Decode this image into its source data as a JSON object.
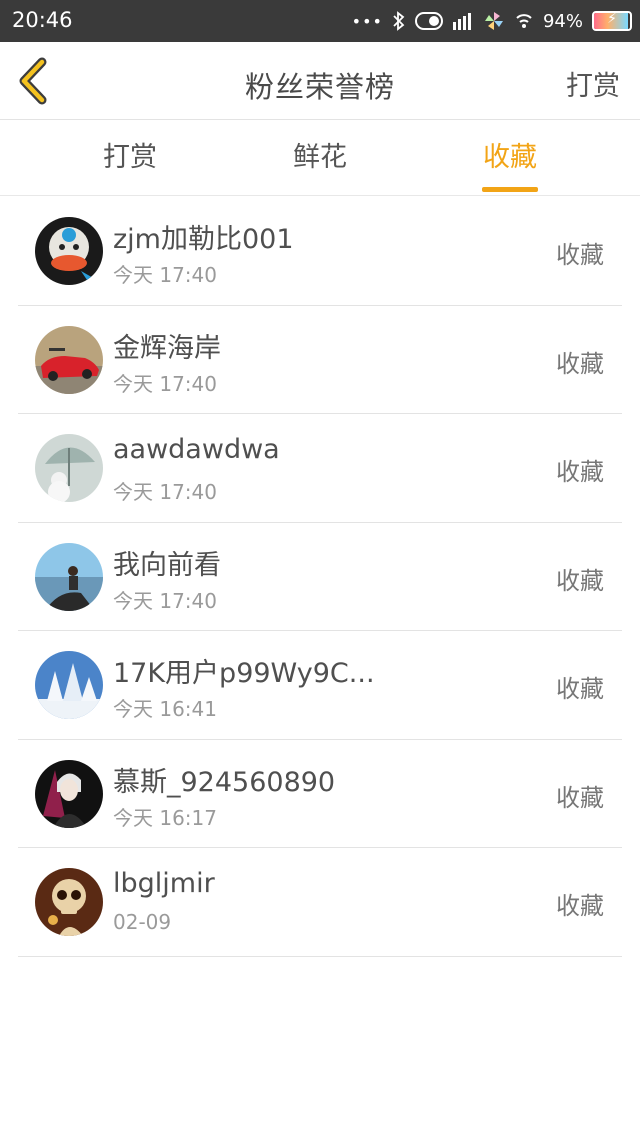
{
  "status_bar": {
    "time": "20:46",
    "dots": "•••",
    "battery": "94%",
    "battery_level": 0.94,
    "icons": [
      "bluetooth-icon",
      "toggle-icon",
      "signal-icon",
      "pinwheel-icon",
      "wifi-icon",
      "battery-icon"
    ]
  },
  "header": {
    "title": "粉丝荣誉榜",
    "action_label": "打赏",
    "back_icon": "chevron-left-icon",
    "accent": "#f2a416"
  },
  "tabs": [
    {
      "label": "打赏",
      "active": false
    },
    {
      "label": "鲜花",
      "active": false
    },
    {
      "label": "收藏",
      "active": true
    }
  ],
  "fans": [
    {
      "name": "zjm加勒比001",
      "time": "今天 17:40",
      "action": "收藏",
      "avatar": "monkey-avatar"
    },
    {
      "name": "金辉海岸",
      "time": "今天 17:40",
      "action": "收藏",
      "avatar": "red-car-avatar"
    },
    {
      "name": "aawdawdwa",
      "time": "今天 17:40",
      "action": "收藏",
      "avatar": "snowman-umbrella-avatar"
    },
    {
      "name": "我向前看",
      "time": "今天 17:40",
      "action": "收藏",
      "avatar": "person-sea-avatar"
    },
    {
      "name": "17K用户p99Wy9C...",
      "time": "今天 16:41",
      "action": "收藏",
      "avatar": "snowy-trees-avatar"
    },
    {
      "name": "慕斯_924560890",
      "time": "今天 16:17",
      "action": "收藏",
      "avatar": "anime-boy-avatar"
    },
    {
      "name": "lbgljmir",
      "time": "02-09",
      "action": "收藏",
      "avatar": "skull-avatar"
    }
  ]
}
